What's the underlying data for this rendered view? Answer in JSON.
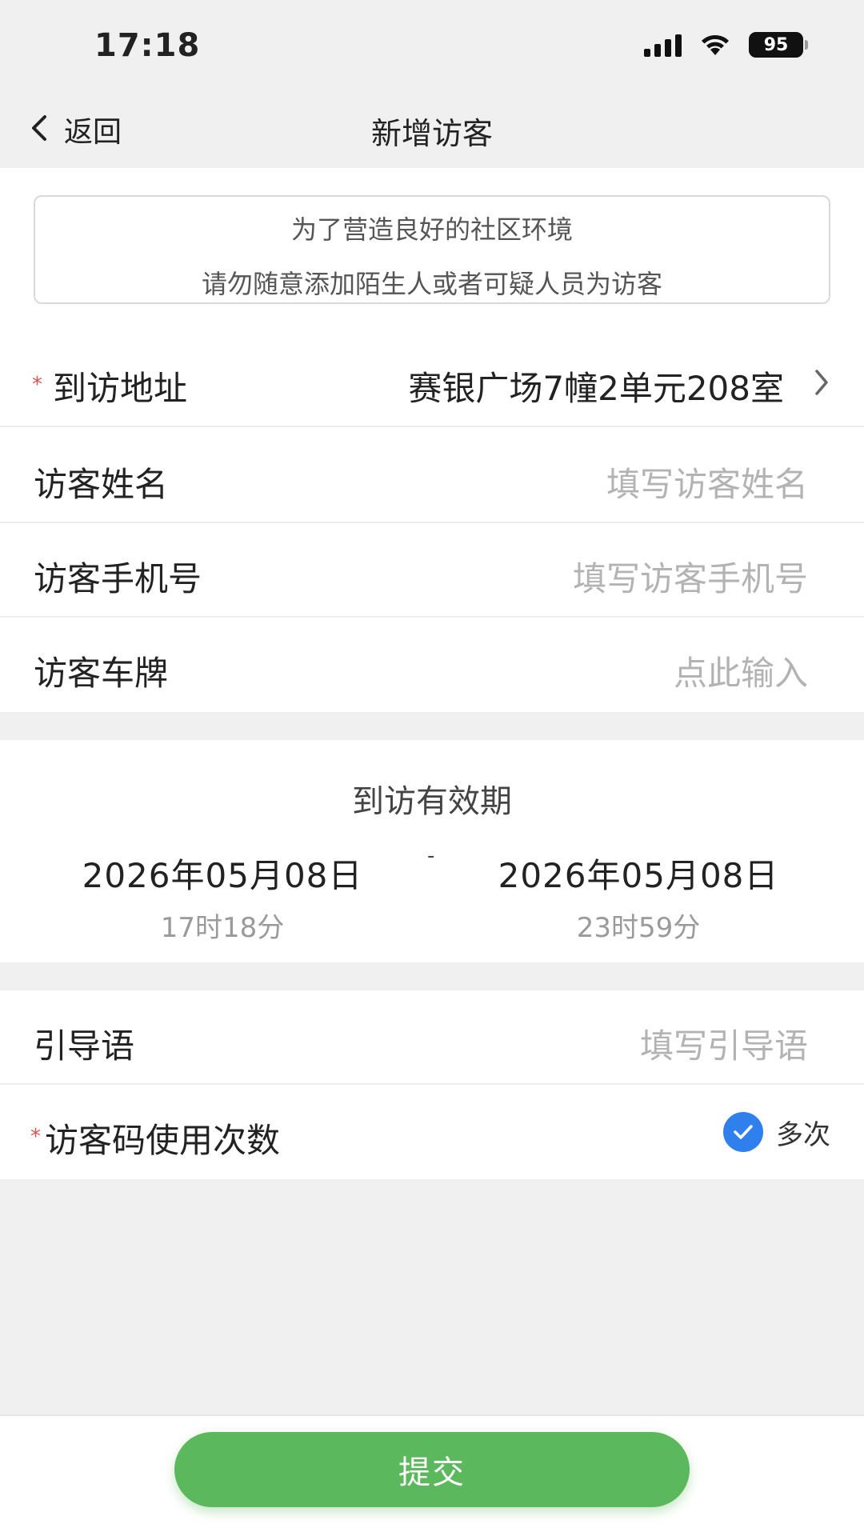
{
  "status_bar": {
    "time": "17:18",
    "battery": "95"
  },
  "nav": {
    "back_label": "返回",
    "title": "新增访客"
  },
  "notice": {
    "line1": "为了营造良好的社区环境",
    "line2": "请勿随意添加陌生人或者可疑人员为访客"
  },
  "form": {
    "address": {
      "label": "到访地址",
      "value": "赛银广场7幢2单元208室"
    },
    "name": {
      "label": "访客姓名",
      "placeholder": "填写访客姓名"
    },
    "phone": {
      "label": "访客手机号",
      "placeholder": "填写访客手机号"
    },
    "plate": {
      "label": "访客车牌",
      "placeholder": "点此输入"
    }
  },
  "validity": {
    "title": "到访有效期",
    "start": {
      "date": "2026年05月08日",
      "time": "17时18分"
    },
    "end": {
      "date": "2026年05月08日",
      "time": "23时59分"
    },
    "separator": "-"
  },
  "guide": {
    "label": "引导语",
    "placeholder": "填写引导语"
  },
  "usage": {
    "label": "访客码使用次数",
    "option": "多次",
    "checked": true
  },
  "submit_label": "提交",
  "colors": {
    "accent_green": "#5cb85c",
    "check_blue": "#2f80ed",
    "required_red": "#e0534a"
  }
}
